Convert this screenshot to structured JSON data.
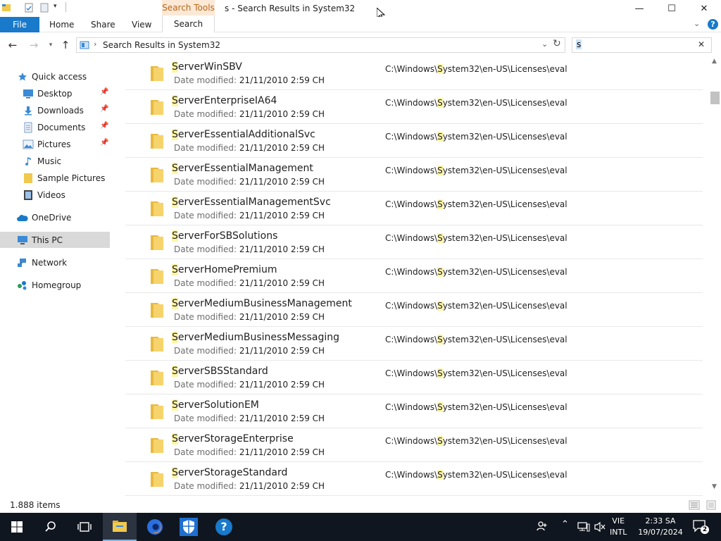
{
  "window": {
    "title": "s - Search Results in System32",
    "contextual_tab_group": "Search Tools",
    "controls": {
      "minimize": "—",
      "maximize": "☐",
      "close": "✕"
    }
  },
  "ribbon": {
    "file_tab": "File",
    "tabs": [
      "Home",
      "Share",
      "View"
    ],
    "search_tab": "Search",
    "help": "?"
  },
  "address": {
    "path": "Search Results in System32",
    "separator": "›"
  },
  "search": {
    "value": "s",
    "clear": "✕"
  },
  "navpane": {
    "items": [
      {
        "label": "Quick access",
        "icon": "star-icon",
        "pinned": false
      },
      {
        "label": "Desktop",
        "icon": "desktop-icon",
        "pinned": true
      },
      {
        "label": "Downloads",
        "icon": "downloads-icon",
        "pinned": true
      },
      {
        "label": "Documents",
        "icon": "documents-icon",
        "pinned": true
      },
      {
        "label": "Pictures",
        "icon": "pictures-icon",
        "pinned": true
      },
      {
        "label": "Music",
        "icon": "music-icon",
        "pinned": false
      },
      {
        "label": "Sample Pictures",
        "icon": "folder-icon",
        "pinned": false
      },
      {
        "label": "Videos",
        "icon": "videos-icon",
        "pinned": false
      },
      {
        "label": "OneDrive",
        "icon": "onedrive-icon",
        "pinned": false
      },
      {
        "label": "This PC",
        "icon": "this-pc-icon",
        "pinned": false,
        "selected": true
      },
      {
        "label": "Network",
        "icon": "network-icon",
        "pinned": false
      },
      {
        "label": "Homegroup",
        "icon": "homegroup-icon",
        "pinned": false
      }
    ],
    "pin_glyph": "📌"
  },
  "results": {
    "date_label": "Date modified:",
    "items": [
      {
        "name_hl": "S",
        "name_rest": "erverWinSBV",
        "date": "21/11/2010 2:59 CH",
        "path_pre": "C:\\Windows\\",
        "path_hl": "S",
        "path_post": "ystem32\\en-US\\Licenses\\eval"
      },
      {
        "name_hl": "S",
        "name_rest": "erverEnterpriseIA64",
        "date": "21/11/2010 2:59 CH",
        "path_pre": "C:\\Windows\\",
        "path_hl": "S",
        "path_post": "ystem32\\en-US\\Licenses\\eval"
      },
      {
        "name_hl": "S",
        "name_rest": "erverEssentialAdditionalSvc",
        "date": "21/11/2010 2:59 CH",
        "path_pre": "C:\\Windows\\",
        "path_hl": "S",
        "path_post": "ystem32\\en-US\\Licenses\\eval"
      },
      {
        "name_hl": "S",
        "name_rest": "erverEssentialManagement",
        "date": "21/11/2010 2:59 CH",
        "path_pre": "C:\\Windows\\",
        "path_hl": "S",
        "path_post": "ystem32\\en-US\\Licenses\\eval"
      },
      {
        "name_hl": "S",
        "name_rest": "erverEssentialManagementSvc",
        "date": "21/11/2010 2:59 CH",
        "path_pre": "C:\\Windows\\",
        "path_hl": "S",
        "path_post": "ystem32\\en-US\\Licenses\\eval"
      },
      {
        "name_hl": "S",
        "name_rest": "erverForSBSolutions",
        "date": "21/11/2010 2:59 CH",
        "path_pre": "C:\\Windows\\",
        "path_hl": "S",
        "path_post": "ystem32\\en-US\\Licenses\\eval"
      },
      {
        "name_hl": "S",
        "name_rest": "erverHomePremium",
        "date": "21/11/2010 2:59 CH",
        "path_pre": "C:\\Windows\\",
        "path_hl": "S",
        "path_post": "ystem32\\en-US\\Licenses\\eval"
      },
      {
        "name_hl": "S",
        "name_rest": "erverMediumBusinessManagement",
        "date": "21/11/2010 2:59 CH",
        "path_pre": "C:\\Windows\\",
        "path_hl": "S",
        "path_post": "ystem32\\en-US\\Licenses\\eval"
      },
      {
        "name_hl": "S",
        "name_rest": "erverMediumBusinessMessaging",
        "date": "21/11/2010 2:59 CH",
        "path_pre": "C:\\Windows\\",
        "path_hl": "S",
        "path_post": "ystem32\\en-US\\Licenses\\eval"
      },
      {
        "name_hl": "S",
        "name_rest": "erverSBSStandard",
        "date": "21/11/2010 2:59 CH",
        "path_pre": "C:\\Windows\\",
        "path_hl": "S",
        "path_post": "ystem32\\en-US\\Licenses\\eval"
      },
      {
        "name_hl": "S",
        "name_rest": "erverSolutionEM",
        "date": "21/11/2010 2:59 CH",
        "path_pre": "C:\\Windows\\",
        "path_hl": "S",
        "path_post": "ystem32\\en-US\\Licenses\\eval"
      },
      {
        "name_hl": "S",
        "name_rest": "erverStorageEnterprise",
        "date": "21/11/2010 2:59 CH",
        "path_pre": "C:\\Windows\\",
        "path_hl": "S",
        "path_post": "ystem32\\en-US\\Licenses\\eval"
      },
      {
        "name_hl": "S",
        "name_rest": "erverStorageStandard",
        "date": "21/11/2010 2:59 CH",
        "path_pre": "C:\\Windows\\",
        "path_hl": "S",
        "path_post": "ystem32\\en-US\\Licenses\\eval"
      }
    ]
  },
  "statusbar": {
    "item_count": "1.888 items"
  },
  "taskbar": {
    "apps": [
      "start-icon",
      "search-icon",
      "task-view-icon",
      "file-explorer-icon",
      "firefox-icon",
      "security-icon",
      "help-icon"
    ],
    "help_glyph": "?",
    "language": {
      "line1": "VIE",
      "line2": "INTL"
    },
    "time": "2:33 SA",
    "date": "19/07/2024",
    "notification_count": "2"
  },
  "colors": {
    "accent": "#1979ca",
    "highlight": "#fff5a8",
    "contextual_tab": "#fbe9d6",
    "taskbar": "#10161f",
    "folder": "#f0c94e"
  }
}
